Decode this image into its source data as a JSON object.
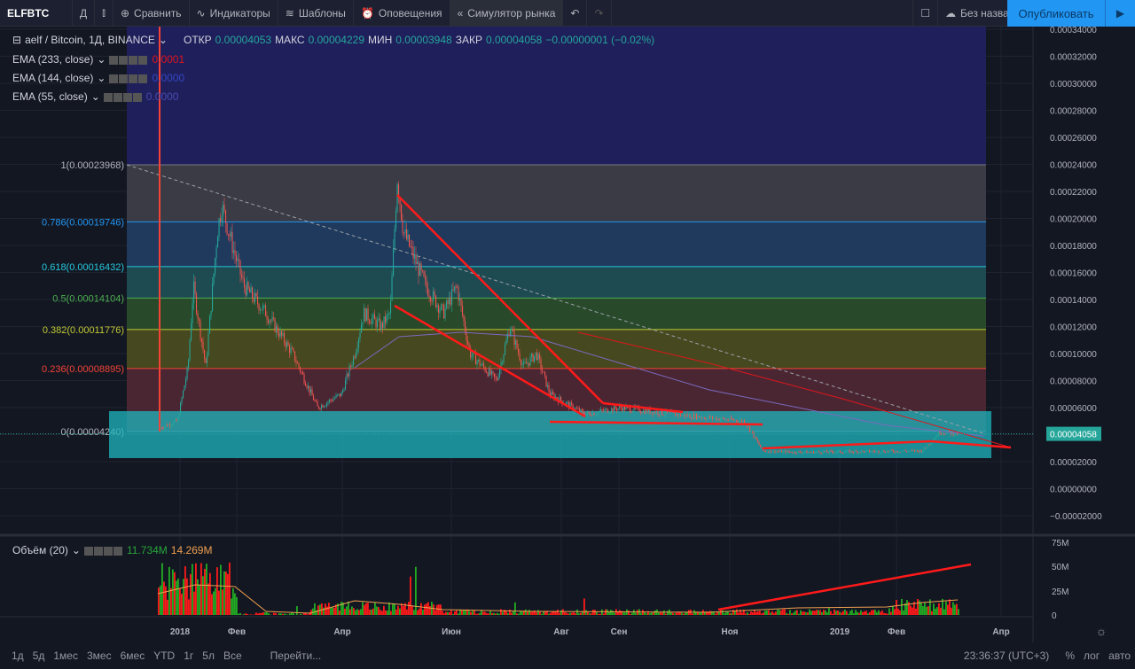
{
  "toolbar": {
    "symbol": "ELFBTC",
    "interval": "Д",
    "compare": "Сравнить",
    "indicators": "Индикаторы",
    "templates": "Шаблоны",
    "alerts": "Оповещения",
    "replay": "Симулятор рынка",
    "layout_name": "Без названия",
    "publish": "Опубликовать"
  },
  "legend": {
    "title": "aelf / Bitcoin, 1Д, BINANCE",
    "open_label": "ОТКР",
    "open": "0.00004053",
    "high_label": "МАКС",
    "high": "0.00004229",
    "low_label": "МИН",
    "low": "0.00003948",
    "close_label": "ЗАКР",
    "close": "0.00004058",
    "change": "−0.00000001 (−0.02%)",
    "ema": [
      {
        "label": "EMA (233, close)",
        "value": "0.0001",
        "color": "#e0161c"
      },
      {
        "label": "EMA (144, close)",
        "value": "0.0000",
        "color": "#3448c0"
      },
      {
        "label": "EMA (55, close)",
        "value": "0.0000",
        "color": "#4a4ab0"
      }
    ],
    "volume": {
      "label": "Объём (20)",
      "value": "11.734M",
      "ma": "14.269M"
    }
  },
  "price_axis": [
    "0.00034000",
    "0.00032000",
    "0.00030000",
    "0.00028000",
    "0.00026000",
    "0.00024000",
    "0.00022000",
    "0.00020000",
    "0.00018000",
    "0.00016000",
    "0.00014000",
    "0.00012000",
    "0.00010000",
    "0.00008000",
    "0.00006000",
    "0.00004000",
    "0.00002000",
    "0.00000000",
    "−0.00002000"
  ],
  "last_price": "0.00004058",
  "fib": [
    {
      "label": "1(0.00023968)",
      "price": 0.00023968
    },
    {
      "label": "0.786(0.00019746)",
      "price": 0.00019746
    },
    {
      "label": "0.618(0.00016432)",
      "price": 0.00016432
    },
    {
      "label": "0.5(0.00014104)",
      "price": 0.00014104
    },
    {
      "label": "0.382(0.00011776)",
      "price": 0.00011776
    },
    {
      "label": "0.236(0.00008895)",
      "price": 8.895e-05
    },
    {
      "label": "0(0.00004240)",
      "price": 4.24e-05
    }
  ],
  "volume_axis": [
    "75M",
    "50M",
    "25M",
    "0"
  ],
  "time_axis": [
    "2018",
    "Фев",
    "Апр",
    "Июн",
    "Авг",
    "Сен",
    "Ноя",
    "2019",
    "Фев",
    "Апр"
  ],
  "ranges": [
    "1д",
    "5д",
    "1мес",
    "3мес",
    "6мес",
    "YTD",
    "1г",
    "5л",
    "Все",
    "Перейти..."
  ],
  "clock": "23:36:37 (UTC+3)",
  "scale_opts": [
    "%",
    "лог",
    "авто"
  ]
}
